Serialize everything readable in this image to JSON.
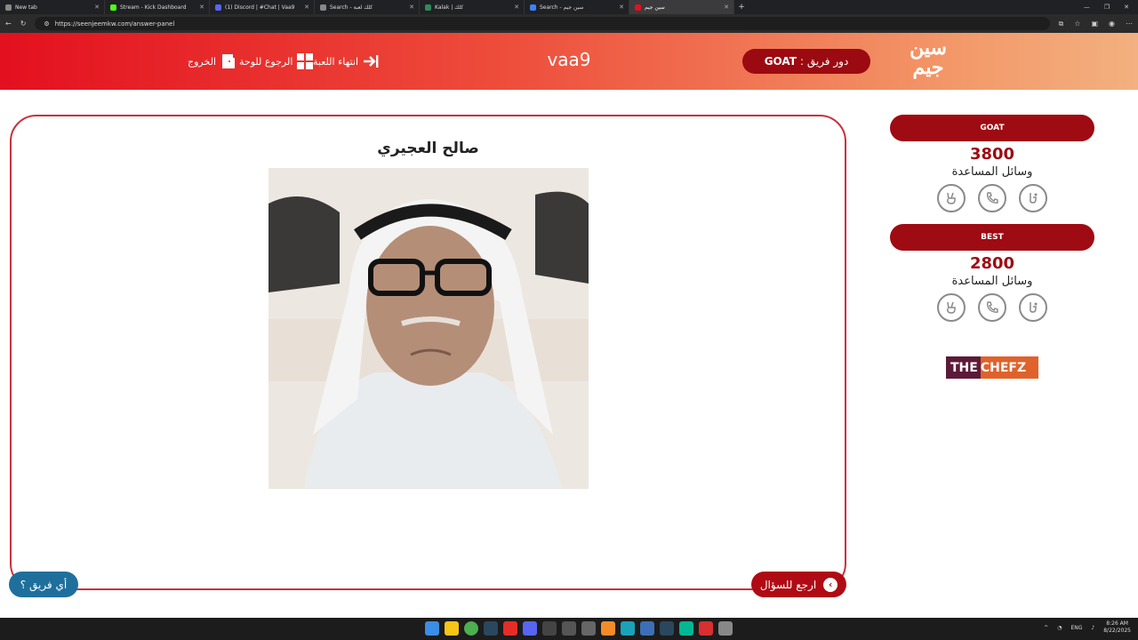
{
  "browser": {
    "tabs": [
      {
        "title": "New tab",
        "active": false
      },
      {
        "title": "Stream - Kick Dashboard",
        "active": false
      },
      {
        "title": "(1) Discord | #Chat | Vaa9",
        "active": false
      },
      {
        "title": "Search - كلك لعبة",
        "active": false
      },
      {
        "title": "Kalak | كلك",
        "active": false
      },
      {
        "title": "Search - سين جيم",
        "active": false
      },
      {
        "title": "سين جيم",
        "active": true
      }
    ],
    "url": "https://seenjeemkw.com/answer-panel"
  },
  "header": {
    "logo_text": "سين جيم",
    "turn_prefix": "دور فريق :",
    "turn_team": "GOAT",
    "room_code": "vaa9",
    "nav": {
      "end_game": "انتهاء اللعبة",
      "back_to_board": "الرجوع للوحة",
      "exit": "الخروج"
    }
  },
  "answer": {
    "name": "صالح العجيري"
  },
  "buttons": {
    "back_to_question": "ارجع للسؤال",
    "which_team": "أي فريق ؟"
  },
  "teams": [
    {
      "name": "GOAT",
      "score": "3800",
      "aids_label": "وسائل المساعدة"
    },
    {
      "name": "BEST",
      "score": "2800",
      "aids_label": "وسائل المساعدة"
    }
  ],
  "sponsor": {
    "part1": "THE",
    "part2": "CHEFZ"
  },
  "taskbar": {
    "lang": "ENG",
    "time": "8:26 AM",
    "date": "8/22/2025"
  },
  "colors": {
    "brand_red": "#9e0b12",
    "header_start": "#e3101f",
    "header_end": "#f3b080",
    "team_button": "#1f6f9d"
  }
}
